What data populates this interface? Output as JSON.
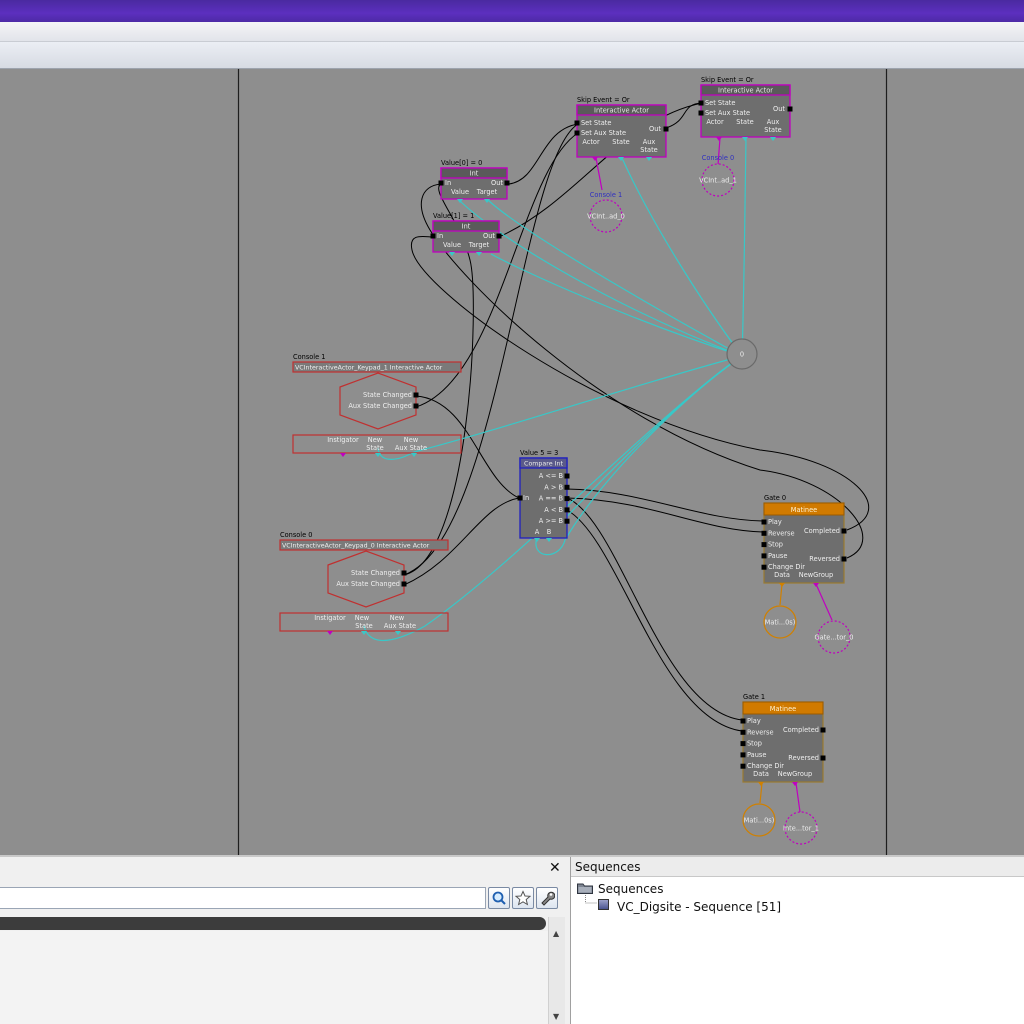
{
  "nodes": {
    "skip_event_0": {
      "caption": "Skip Event = Or",
      "title": "Interactive Actor",
      "inputs": [
        "Set State",
        "Set Aux State"
      ],
      "out": "Out",
      "vars": [
        "Actor",
        "State",
        "Aux State"
      ]
    },
    "skip_event_1": {
      "caption": "Skip Event = Or",
      "title": "Interactive Actor",
      "inputs": [
        "Set State",
        "Set Aux State"
      ],
      "out": "Out",
      "vars": [
        "Actor",
        "State",
        "Aux State"
      ]
    },
    "value0": {
      "caption": "Value[0] = 0",
      "title": "Int",
      "in": "In",
      "out": "Out",
      "vars": [
        "Value",
        "Target"
      ]
    },
    "value1": {
      "caption": "Value[1] = 1",
      "title": "Int",
      "in": "In",
      "out": "Out",
      "vars": [
        "Value",
        "Target"
      ]
    },
    "console1": {
      "caption": "Console 1",
      "title": "VCInteractiveActor_Keypad_1 Interactive Actor",
      "outputs": [
        "State Changed",
        "Aux State Changed"
      ],
      "vars": [
        "Instigator",
        "New State",
        "New Aux State"
      ]
    },
    "console0": {
      "caption": "Console 0",
      "title": "VCInteractiveActor_Keypad_0 Interactive Actor",
      "outputs": [
        "State Changed",
        "Aux State Changed"
      ],
      "vars": [
        "Instigator",
        "New State",
        "New Aux State"
      ]
    },
    "compare": {
      "caption": "Value 5 = 3",
      "title": "Compare Int",
      "in": "In",
      "outputs": [
        "A <= B",
        "A > B",
        "A == B",
        "A < B",
        "A >= B"
      ],
      "vars": [
        "A",
        "B"
      ]
    },
    "gate0": {
      "caption": "Gate 0",
      "title": "Matinee",
      "inputs": [
        "Play",
        "Reverse",
        "Stop",
        "Pause",
        "Change Dir"
      ],
      "outputs": [
        "Completed",
        "Reversed"
      ],
      "vars": [
        "Data",
        "NewGroup"
      ]
    },
    "gate1": {
      "caption": "Gate 1",
      "title": "Matinee",
      "inputs": [
        "Play",
        "Reverse",
        "Stop",
        "Pause",
        "Change Dir"
      ],
      "outputs": [
        "Completed",
        "Reversed"
      ],
      "vars": [
        "Data",
        "NewGroup"
      ]
    }
  },
  "var_circles": {
    "console0_top": {
      "caption": "Console 0",
      "label": "VCInt..ad_1"
    },
    "console1": {
      "caption": "Console 1",
      "label": "VCInt..ad_0"
    },
    "zero": {
      "label": "0"
    },
    "mat0": {
      "label": "Mati...0s)"
    },
    "gate0_obj": {
      "label": "Gate...tor_0"
    },
    "mat1": {
      "label": "Mati...0s)"
    },
    "gate1_obj": {
      "label": "Inte...tor_1"
    }
  },
  "bottom": {
    "close_label": "✕",
    "sequences_header": "Sequences",
    "tree_root": "Sequences",
    "tree_child": "VC_Digsite - Sequence [51]"
  },
  "colors": {
    "titlebar": "#5c2fbf",
    "canvas_bg": "#8e8e8e",
    "action_border": "#c000c0",
    "event_border": "#c03030",
    "condition_border": "#2020c0",
    "matinee_header": "#d07a00",
    "link_cyan": "#38c8c8",
    "link_black": "#000000"
  },
  "icons": [
    "search-icon",
    "star-icon",
    "wrench-icon",
    "folder-icon",
    "sequence-icon",
    "close-icon"
  ]
}
